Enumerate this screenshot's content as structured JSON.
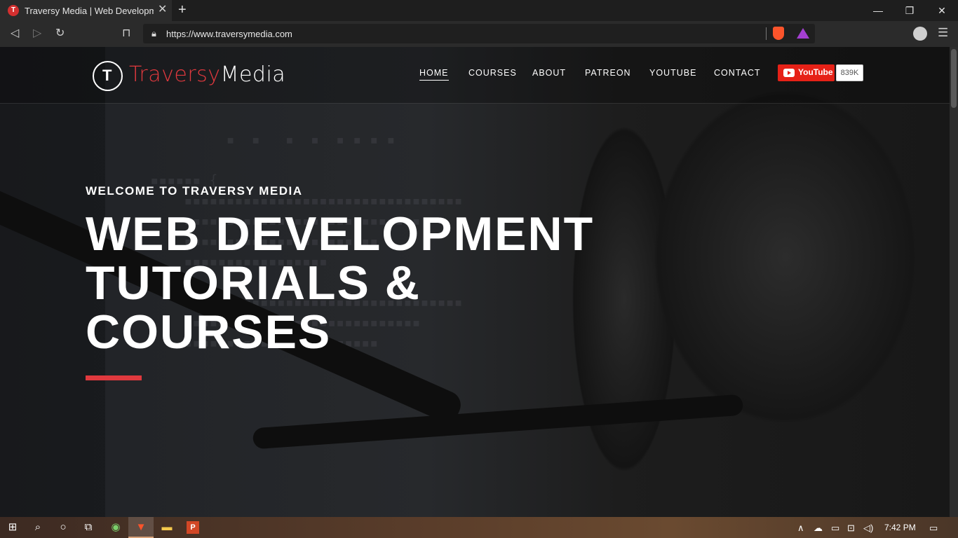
{
  "browser": {
    "tab_title": "Traversy Media | Web Development",
    "tab_favicon": "T",
    "url": "https://www.traversymedia.com"
  },
  "site": {
    "logo_part1": "Traversy",
    "logo_part2": "Media",
    "nav": [
      "HOME",
      "COURSES",
      "ABOUT",
      "PATREON",
      "YOUTUBE",
      "CONTACT"
    ],
    "youtube_label": "YouTube",
    "youtube_count": "839K"
  },
  "hero": {
    "welcome": "WELCOME TO TRAVERSY MEDIA",
    "title_line1": "WEB DEVELOPMENT",
    "title_line2": "TUTORIALS &",
    "title_line3": "COURSES"
  },
  "taskbar": {
    "time": "7:42 PM"
  },
  "colors": {
    "accent": "#e0393e",
    "youtube_red": "#e62117",
    "browser_dark": "#2b2b2b"
  }
}
